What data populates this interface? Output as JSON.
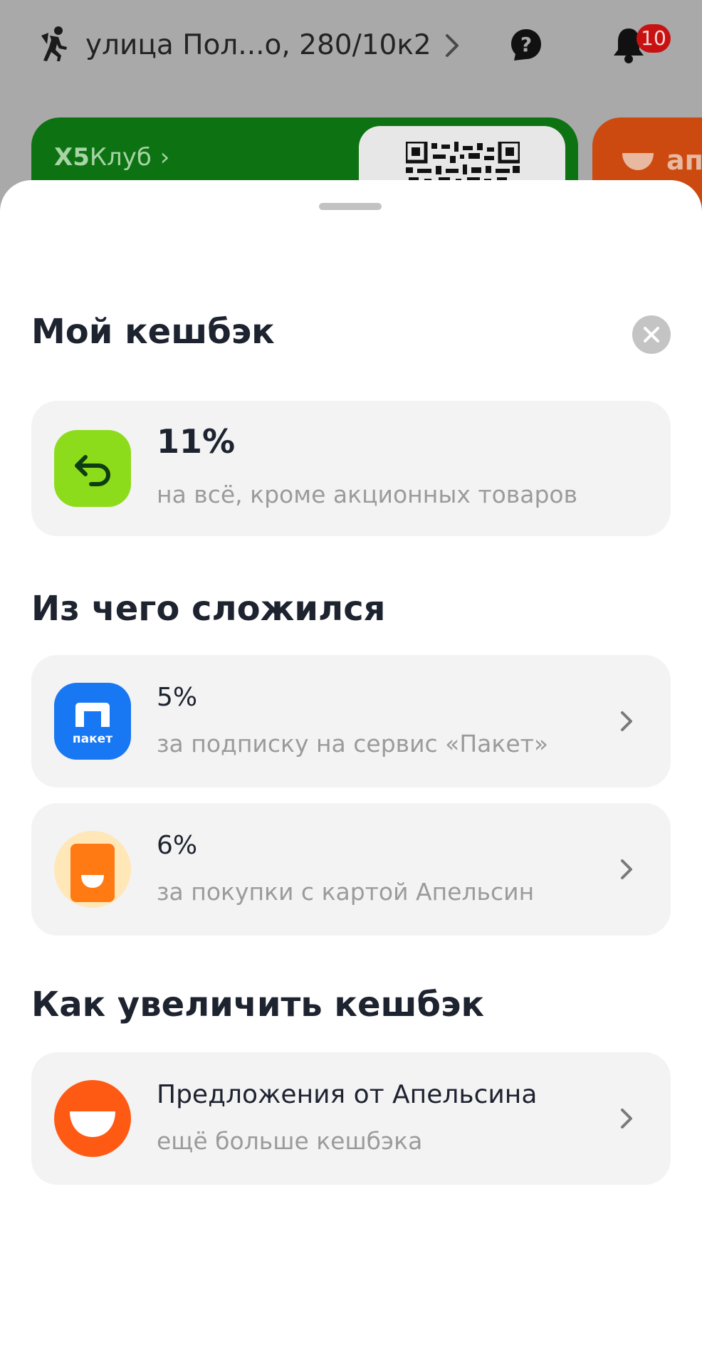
{
  "topbar": {
    "address": "улица Пол...о, 280/10к2",
    "notifications_count": "10"
  },
  "promo_cards": {
    "x5_brand": "X5",
    "x5_club": "Клуб",
    "x5_chevron": "›",
    "orange_card_text": "ап"
  },
  "sheet": {
    "title": "Мой кешбэк",
    "total": {
      "percent": "11%",
      "description": "на всё, кроме акционных товаров"
    },
    "breakdown_title": "Из чего сложился",
    "breakdown": [
      {
        "percent": "5%",
        "description": "за подписку на сервис «Пакет»",
        "icon": "paket-icon",
        "icon_label": "пакет"
      },
      {
        "percent": "6%",
        "description": "за покупки с картой Апельсин",
        "icon": "apelsin-card-icon"
      }
    ],
    "increase_title": "Как увеличить кешбэк",
    "offers": [
      {
        "title": "Предложения от Апельсина",
        "description": "ещё больше кешбэка",
        "icon": "apelsin-logo-icon"
      }
    ]
  },
  "colors": {
    "x5_green": "#0d7312",
    "cashback_green": "#8ddc1c",
    "paket_blue": "#1877f2",
    "apelsin_orange": "#ff5a14",
    "badge_red": "#c81212"
  }
}
